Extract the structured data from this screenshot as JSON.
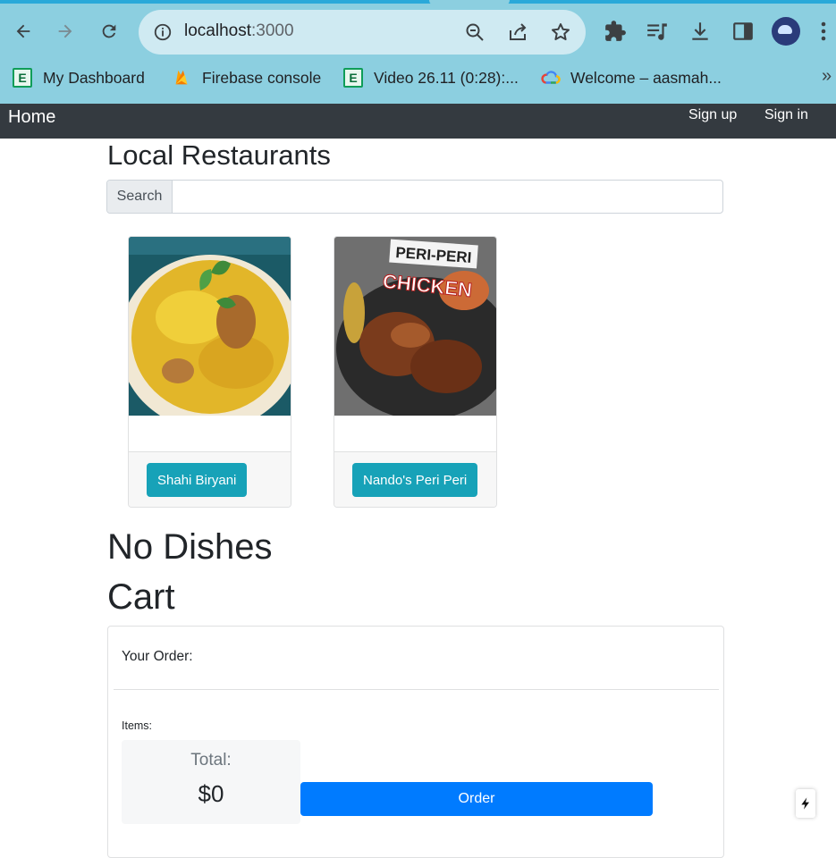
{
  "browser": {
    "url_host": "localhost",
    "url_port": ":3000",
    "bookmarks": [
      {
        "label": "My Dashboard",
        "icon": "e-icon"
      },
      {
        "label": "Firebase console",
        "icon": "firebase-icon"
      },
      {
        "label": "Video 26.11 (0:28):...",
        "icon": "e-icon"
      },
      {
        "label": "Welcome – aasmah...",
        "icon": "google-cloud-icon"
      }
    ],
    "more_bookmarks": "»"
  },
  "navbar": {
    "brand": "Home",
    "links": [
      "Sign up",
      "Sign in"
    ]
  },
  "restaurants": {
    "title": "Local Restaurants",
    "search_label": "Search",
    "search_value": "",
    "items": [
      {
        "name": "Shahi Biryani",
        "image": "biryani-photo"
      },
      {
        "name": "Nando's Peri Peri",
        "image": "peri-peri-chicken-photo",
        "image_text_1": "PERI-PERI",
        "image_text_2": "CHICKEN"
      }
    ]
  },
  "dishes": {
    "empty_message": "No Dishes"
  },
  "cart": {
    "title": "Cart",
    "your_order_label": "Your Order:",
    "items_label": "Items:",
    "total_label": "Total:",
    "total_value": "$0",
    "order_button": "Order"
  },
  "colors": {
    "navbar": "#343a40",
    "info_button": "#17a2b8",
    "primary_button": "#007bff",
    "browser_chrome": "#8ccfe0"
  }
}
